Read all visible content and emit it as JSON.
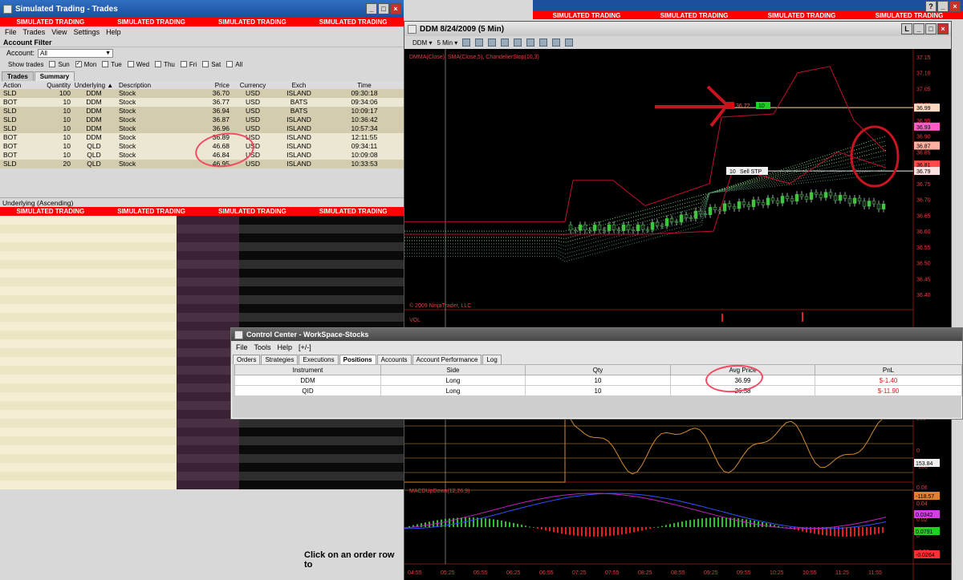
{
  "trades_window": {
    "title": "Simulated Trading - Trades",
    "sim_label": "SIMULATED TRADING",
    "menu": [
      "File",
      "Trades",
      "View",
      "Settings",
      "Help"
    ],
    "account_filter_label": "Account Filter",
    "account_label": "Account:",
    "account_value": "All",
    "show_trades_label": "Show trades",
    "days": [
      {
        "label": "Sun",
        "checked": false
      },
      {
        "label": "Mon",
        "checked": true
      },
      {
        "label": "Tue",
        "checked": false
      },
      {
        "label": "Wed",
        "checked": false
      },
      {
        "label": "Thu",
        "checked": false
      },
      {
        "label": "Fri",
        "checked": false
      },
      {
        "label": "Sat",
        "checked": false
      },
      {
        "label": "All",
        "checked": false
      }
    ],
    "tabs": [
      "Trades",
      "Summary"
    ],
    "columns": [
      "Action",
      "Quantity",
      "Underlying",
      "Description",
      "Price",
      "Currency",
      "Exch",
      "Time"
    ],
    "rows": [
      [
        "SLD",
        "100",
        "DDM",
        "Stock",
        "36.70",
        "USD",
        "ISLAND",
        "09:30:18"
      ],
      [
        "BOT",
        "10",
        "DDM",
        "Stock",
        "36.77",
        "USD",
        "BATS",
        "09:34:06"
      ],
      [
        "SLD",
        "10",
        "DDM",
        "Stock",
        "36.94",
        "USD",
        "BATS",
        "10:09:17"
      ],
      [
        "SLD",
        "10",
        "DDM",
        "Stock",
        "36.87",
        "USD",
        "ISLAND",
        "10:36:42"
      ],
      [
        "SLD",
        "10",
        "DDM",
        "Stock",
        "36.96",
        "USD",
        "ISLAND",
        "10:57:34"
      ],
      [
        "BOT",
        "10",
        "DDM",
        "Stock",
        "36.89",
        "USD",
        "ISLAND",
        "12:11:55"
      ],
      [
        "BOT",
        "10",
        "QLD",
        "Stock",
        "46.68",
        "USD",
        "ISLAND",
        "09:34:11"
      ],
      [
        "BOT",
        "10",
        "QLD",
        "Stock",
        "46.84",
        "USD",
        "ISLAND",
        "10:09:08"
      ],
      [
        "SLD",
        "20",
        "QLD",
        "Stock",
        "46.95",
        "USD",
        "ISLAND",
        "10:33:53"
      ]
    ],
    "underlying_header": "Underlying (Ascending)",
    "hint": "Click on an order row to"
  },
  "chart_window": {
    "title": "DDM  8/24/2009 (5 Min)",
    "toolbar_symbol": "DDM",
    "toolbar_interval": "5 Min",
    "indicator_label": "DMMA(Close), SMA(Close,5), ChandelierStop(10,3)",
    "copyright": "© 2009 NinjaTrader, LLC",
    "vol_label": "VOL",
    "macd_label": "MACDUpDown(12,26,9)",
    "order_tags": {
      "buy_qty": "10",
      "buy_price": "36.72",
      "sell_text": "Sell STP",
      "sell_qty": "10"
    },
    "colors": {
      "candle_up": "#3fc53f",
      "envelope": "#c0102e",
      "annotation": "#c81420"
    }
  },
  "chart_data": [
    {
      "type": "line",
      "name": "price",
      "x_ticks": [
        "04:55",
        "05:25",
        "05:55",
        "06:25",
        "06:55",
        "07:25",
        "07:55",
        "08:25",
        "08:55",
        "09:25",
        "09:55",
        "10:25",
        "10:55",
        "11:25",
        "11:55"
      ],
      "y_ticks": [
        "37.15",
        "37.10",
        "37.05",
        "37.00",
        "36.95",
        "36.90",
        "36.85",
        "36.80",
        "36.75",
        "36.70",
        "36.65",
        "36.60",
        "36.55",
        "36.50",
        "36.45",
        "36.40"
      ],
      "price_markers": [
        "36.99",
        "36.93",
        "36.87",
        "36.81",
        "36.79"
      ],
      "ylim": [
        36.4,
        37.15
      ]
    },
    {
      "type": "line",
      "name": "CCI",
      "y_ticks": [
        "200",
        "0",
        "-200"
      ],
      "markers": [
        "153.84",
        "-118.57"
      ]
    },
    {
      "type": "bar",
      "name": "MACD",
      "y_ticks": [
        "0.06",
        "0.04",
        "0.02",
        "0",
        "-0.02"
      ],
      "markers": [
        "0.0342",
        "0.0791",
        "-0.0264"
      ]
    }
  ],
  "control_center": {
    "title": "Control Center - WorkSpace-Stocks",
    "menu": [
      "File",
      "Tools",
      "Help",
      "[+/-]"
    ],
    "tabs": [
      "Orders",
      "Strategies",
      "Executions",
      "Positions",
      "Accounts",
      "Account Performance",
      "Log"
    ],
    "active_tab": "Positions",
    "columns": [
      "Instrument",
      "Side",
      "Qty",
      "Avg Price",
      "PnL"
    ],
    "rows": [
      [
        "DDM",
        "Long",
        "10",
        "36.99",
        "$-1.40"
      ],
      [
        "QID",
        "Long",
        "10",
        "26.58",
        "$-11.90"
      ]
    ]
  }
}
